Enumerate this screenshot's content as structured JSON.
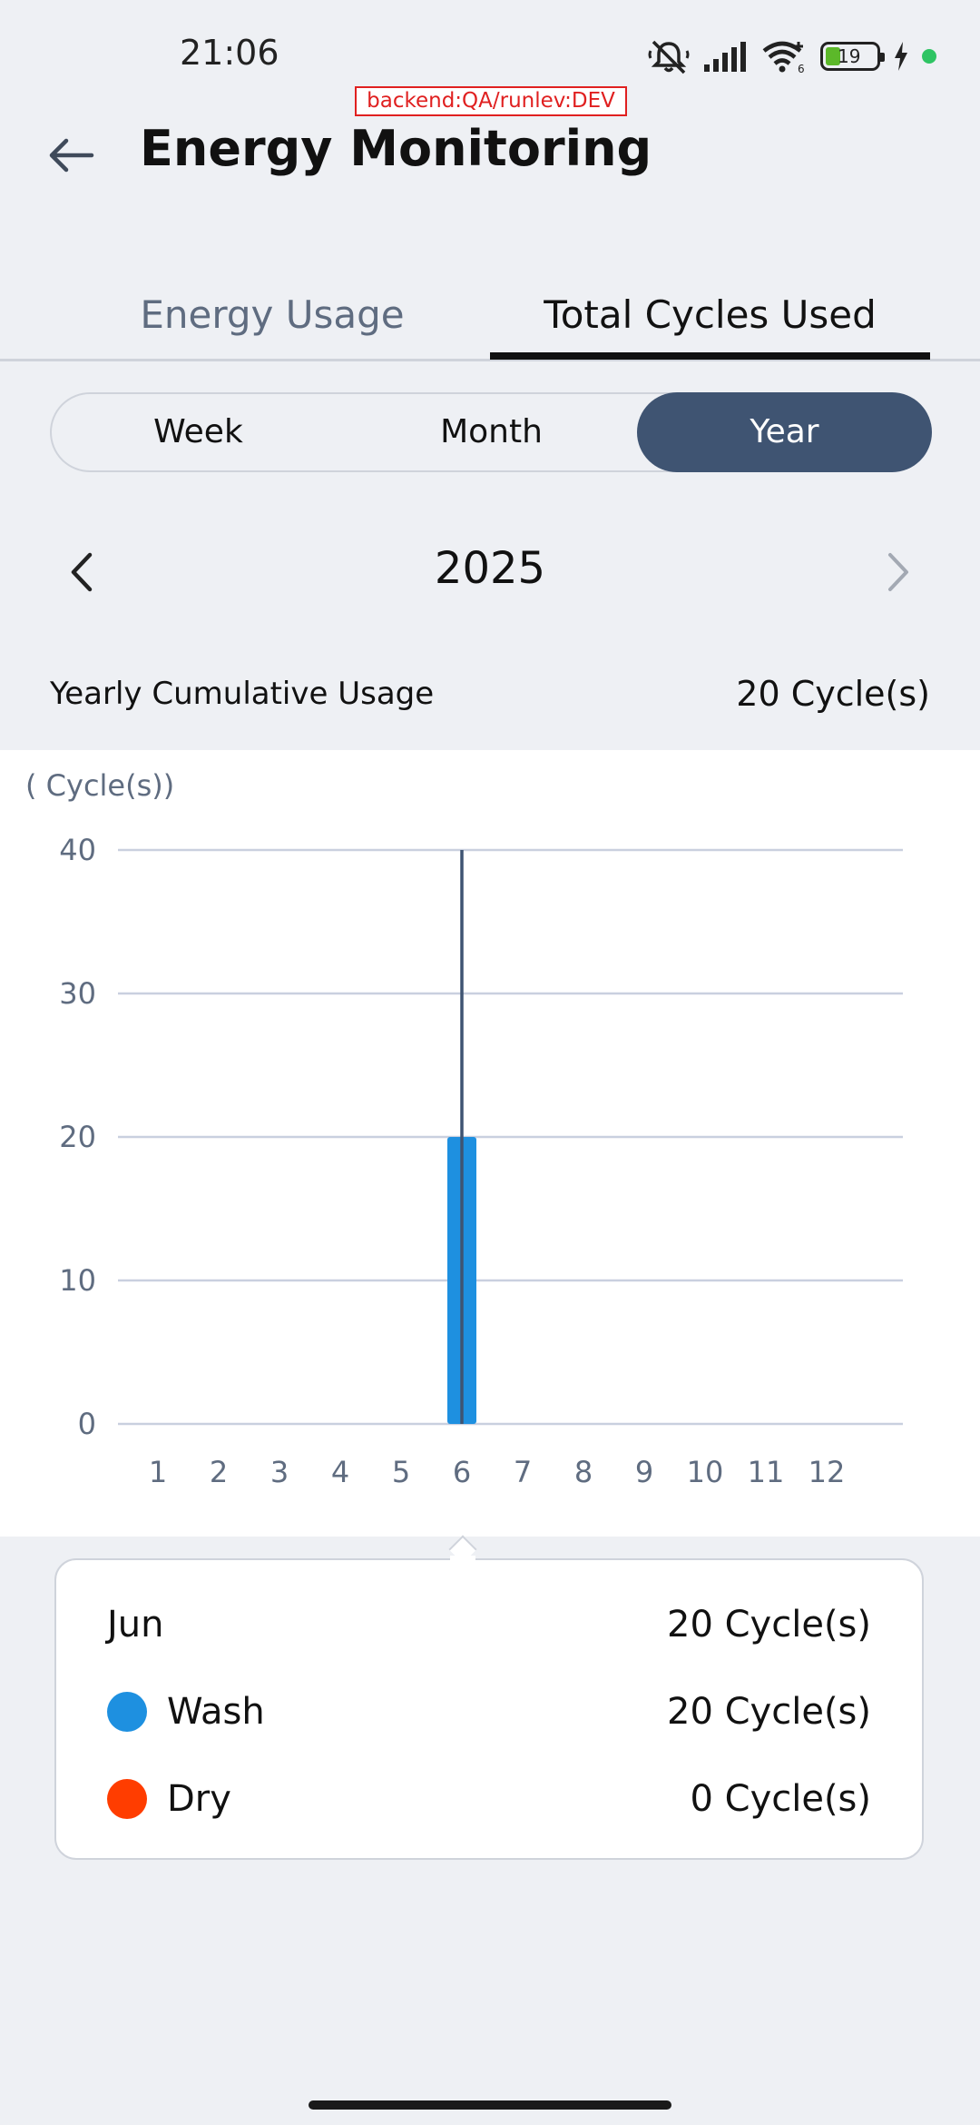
{
  "status_bar": {
    "time": "21:06",
    "battery": "19"
  },
  "debug_badge": "backend:QA/runlev:DEV",
  "header": {
    "title": "Energy Monitoring"
  },
  "tabs": [
    {
      "label": "Energy Usage",
      "selected": false
    },
    {
      "label": "Total Cycles Used",
      "selected": true
    }
  ],
  "period_selector": {
    "options": [
      "Week",
      "Month",
      "Year"
    ],
    "selected": "Year"
  },
  "year_nav": {
    "year": "2025"
  },
  "summary": {
    "label": "Yearly Cumulative Usage",
    "value": "20 Cycle(s)"
  },
  "colors": {
    "wash": "#1e90e0",
    "dry": "#ff3d00",
    "accent": "#3f5472"
  },
  "chart_data": {
    "type": "bar",
    "ylabel": "( Cycle(s))",
    "ylim": [
      0,
      40
    ],
    "yticks": [
      "40",
      "30",
      "20",
      "10",
      "0"
    ],
    "categories": [
      "1",
      "2",
      "3",
      "4",
      "5",
      "6",
      "7",
      "8",
      "9",
      "10",
      "11",
      "12"
    ],
    "series": [
      {
        "name": "Wash",
        "values": [
          0,
          0,
          0,
          0,
          0,
          20,
          0,
          0,
          0,
          0,
          0,
          0
        ]
      },
      {
        "name": "Dry",
        "values": [
          0,
          0,
          0,
          0,
          0,
          0,
          0,
          0,
          0,
          0,
          0,
          0
        ]
      }
    ],
    "selected_category": "6",
    "grid": true
  },
  "tooltip": {
    "month": "Jun",
    "total": "20 Cycle(s)",
    "wash_label": "Wash",
    "wash_value": "20 Cycle(s)",
    "dry_label": "Dry",
    "dry_value": "0 Cycle(s)"
  }
}
